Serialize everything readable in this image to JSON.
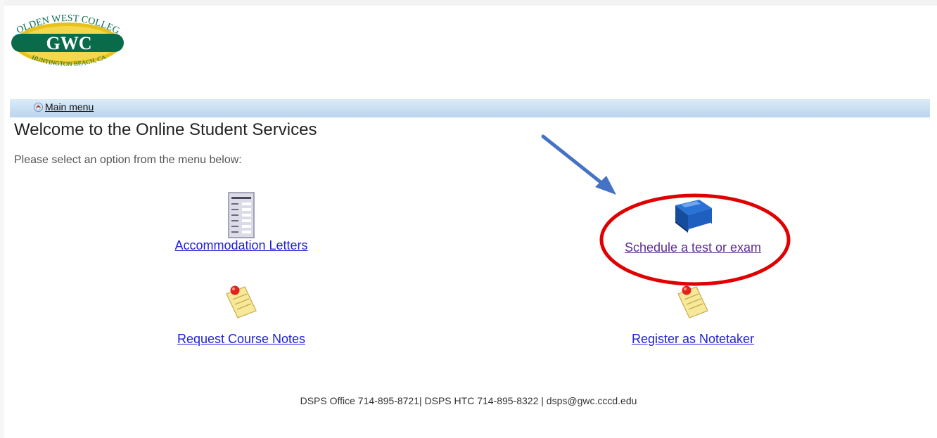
{
  "logo": {
    "top_text": "GOLDEN WEST COLLEGE",
    "main_text": "GWC",
    "bottom_text": "HUNTINGTON BEACH, CA"
  },
  "nav": {
    "main_menu_label": "Main menu",
    "icon": "home-icon"
  },
  "page": {
    "title": "Welcome to the Online Student Services",
    "instruction": "Please select an option from the menu below:"
  },
  "options": [
    {
      "label": "Accommodation Letters",
      "icon": "document-list-icon"
    },
    {
      "label": "Schedule a test or exam",
      "icon": "blue-book-icon"
    },
    {
      "label": "Request Course Notes",
      "icon": "pinned-note-icon"
    },
    {
      "label": "Register as Notetaker",
      "icon": "pinned-note-icon"
    }
  ],
  "footer": {
    "text": "DSPS Office 714-895-8721| DSPS HTC 714-895-8322 | dsps@gwc.cccd.edu"
  },
  "annotation": {
    "arrow_color": "#4472c4",
    "circle_color": "#e00000"
  },
  "colors": {
    "link": "#1f1fd6",
    "visited_link": "#5a2d8c",
    "nav_bar": "#b9d5ee",
    "logo_green": "#0a6b4b",
    "logo_gold": "#e6c21a"
  }
}
